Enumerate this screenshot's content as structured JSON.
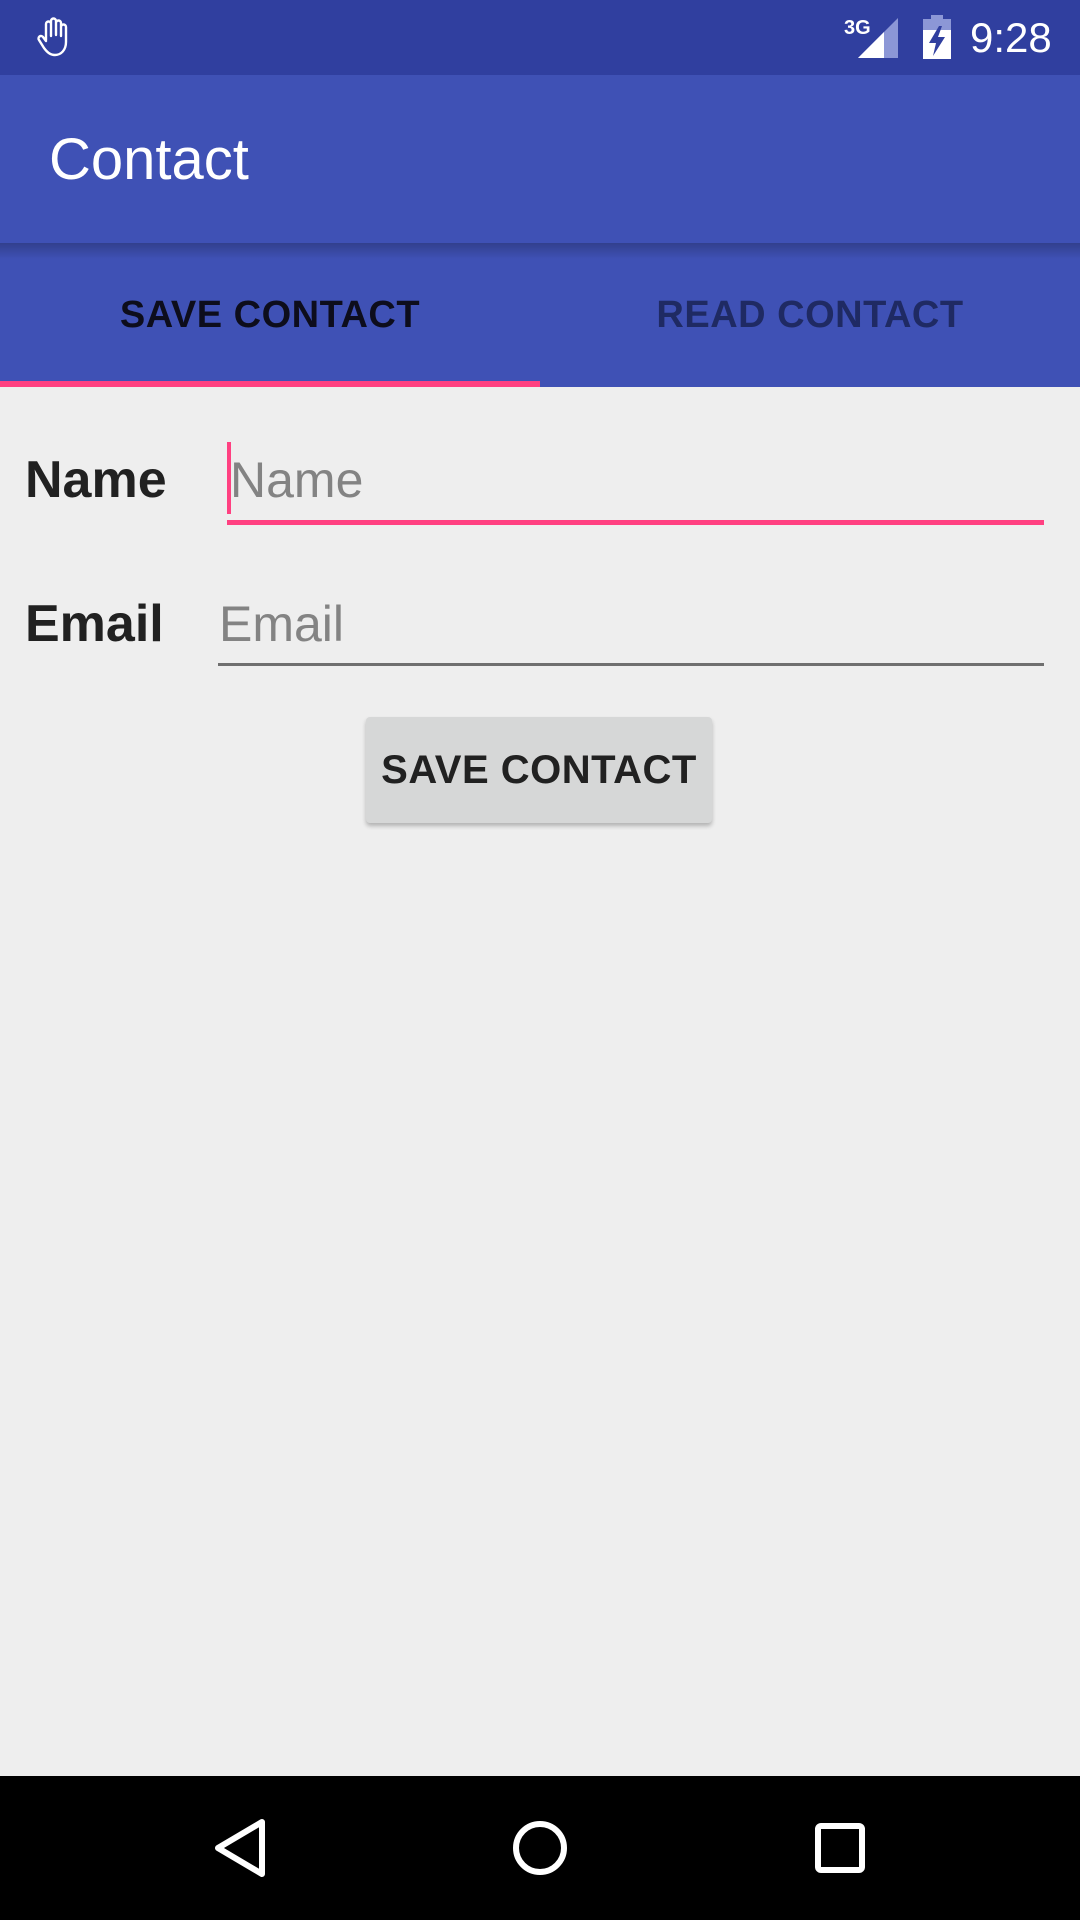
{
  "status_bar": {
    "network": "3G",
    "time": "9:28",
    "icons": [
      "hand-icon",
      "signal-icon",
      "battery-charging-icon"
    ]
  },
  "app_bar": {
    "title": "Contact"
  },
  "tabs": [
    {
      "label": "SAVE CONTACT",
      "selected": true
    },
    {
      "label": "READ CONTACT",
      "selected": false
    }
  ],
  "form": {
    "name": {
      "label": "Name",
      "placeholder": "Name",
      "value": "",
      "focused": true
    },
    "email": {
      "label": "Email",
      "placeholder": "Email",
      "value": ""
    },
    "save_button_label": "SAVE CONTACT"
  },
  "nav_bar": {
    "icons": [
      "back-icon",
      "home-icon",
      "recents-icon"
    ]
  },
  "colors": {
    "primary": "#3f51b5",
    "primary_dark": "#303f9f",
    "accent": "#ff4081",
    "background": "#eeeeee"
  }
}
